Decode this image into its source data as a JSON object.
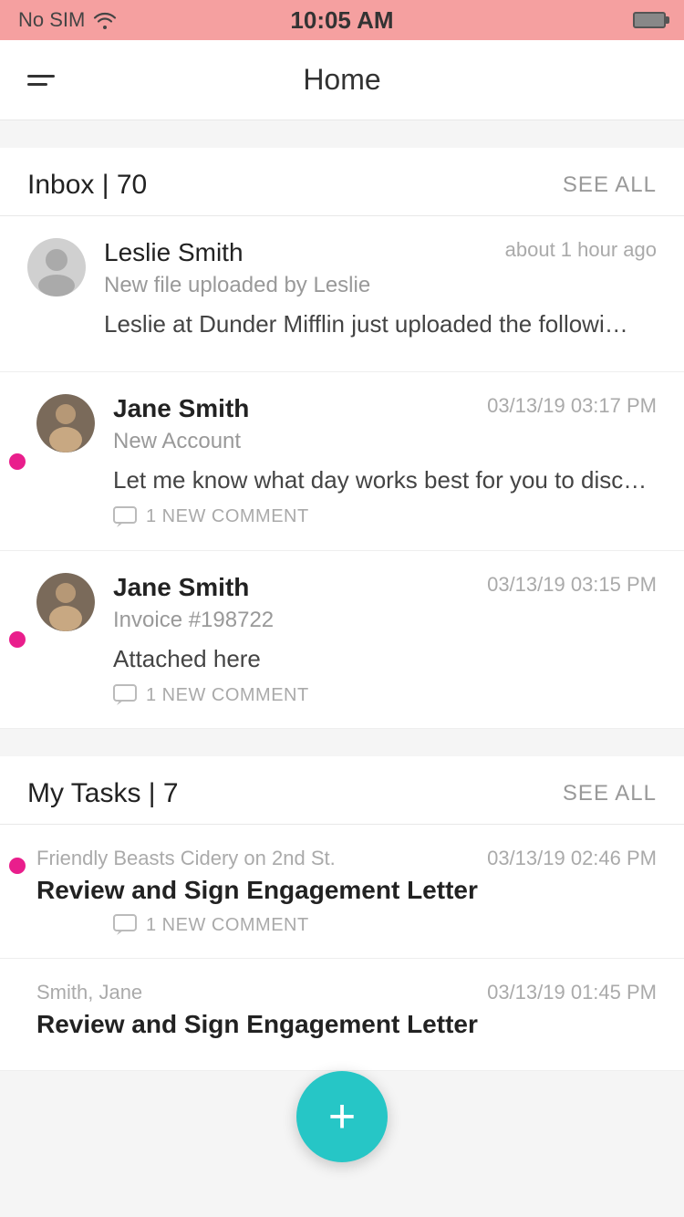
{
  "statusBar": {
    "carrier": "No SIM",
    "time": "10:05 AM",
    "battery": ""
  },
  "header": {
    "title": "Home",
    "menuIcon": "menu-icon"
  },
  "inbox": {
    "sectionTitle": "Inbox | 70",
    "seeAllLabel": "SEE ALL",
    "items": [
      {
        "sender": "Leslie Smith",
        "time": "about 1 hour ago",
        "subject": "New file uploaded by Leslie",
        "preview": "Leslie at Dunder Mifflin just uploaded the followi…",
        "unread": false,
        "hasComment": false,
        "commentText": ""
      },
      {
        "sender": "Jane Smith",
        "time": "03/13/19 03:17 PM",
        "subject": "New Account",
        "preview": "Let me know what day works best for you to disc…",
        "unread": true,
        "hasComment": true,
        "commentText": "1 NEW COMMENT"
      },
      {
        "sender": "Jane Smith",
        "time": "03/13/19 03:15 PM",
        "subject": "Invoice #198722",
        "preview": "Attached here",
        "unread": true,
        "hasComment": true,
        "commentText": "1 NEW COMMENT"
      }
    ]
  },
  "tasks": {
    "sectionTitle": "My Tasks | 7",
    "seeAllLabel": "SEE ALL",
    "items": [
      {
        "company": "Friendly Beasts Cidery on 2nd St.",
        "time": "03/13/19 02:46 PM",
        "name": "Review and Sign Engagement Letter",
        "unread": true,
        "hasComment": true,
        "commentText": "1 NEW COMMENT"
      },
      {
        "company": "Smith, Jane",
        "time": "03/13/19 01:45 PM",
        "name": "Review and Sign Engagement Letter",
        "unread": false,
        "hasComment": false,
        "commentText": ""
      }
    ]
  },
  "fab": {
    "label": "+"
  }
}
